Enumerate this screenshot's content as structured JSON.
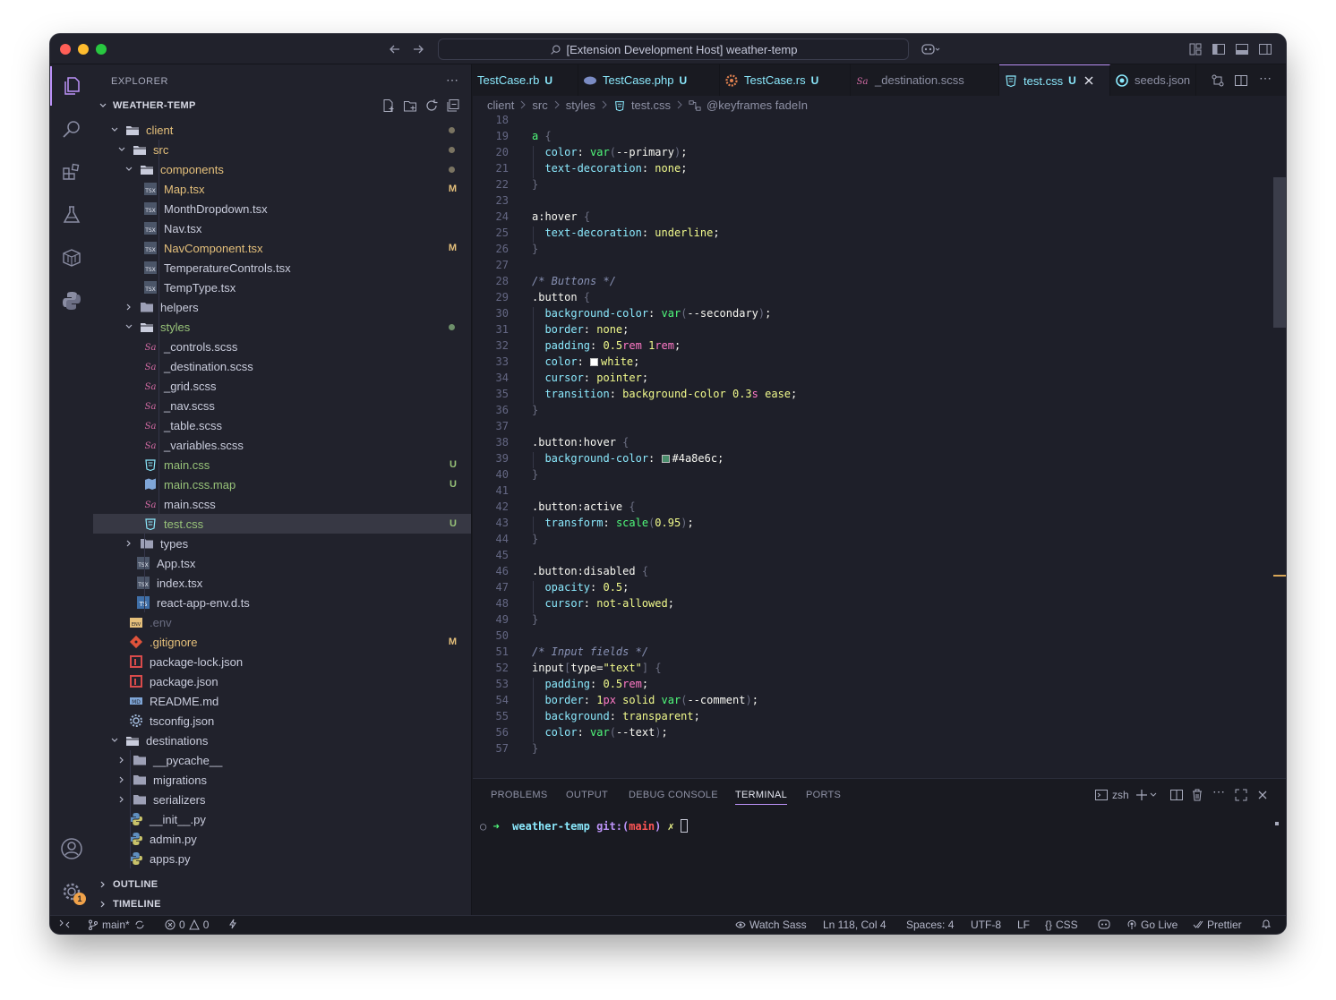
{
  "window": {
    "title": "[Extension Development Host] weather-temp"
  },
  "colors": {
    "accent": "#bd93f9",
    "modified": "#e5c07b",
    "untracked": "#98c379",
    "ignored": "#6b6e82"
  },
  "explorer": {
    "title": "EXPLORER",
    "root": "WEATHER-TEMP",
    "tree": [
      {
        "name": "client",
        "type": "folder",
        "depth": 0,
        "open": true,
        "dot": true,
        "color": "modified"
      },
      {
        "name": "src",
        "type": "folder",
        "depth": 1,
        "open": true,
        "dot": true,
        "color": "modified"
      },
      {
        "name": "components",
        "type": "folder",
        "depth": 2,
        "open": true,
        "dot": true,
        "color": "modified"
      },
      {
        "name": "Map.tsx",
        "type": "tsx",
        "depth": 3,
        "badge": "M",
        "color": "modified"
      },
      {
        "name": "MonthDropdown.tsx",
        "type": "tsx",
        "depth": 3
      },
      {
        "name": "Nav.tsx",
        "type": "tsx",
        "depth": 3
      },
      {
        "name": "NavComponent.tsx",
        "type": "tsx",
        "depth": 3,
        "badge": "M",
        "color": "modified"
      },
      {
        "name": "TemperatureControls.tsx",
        "type": "tsx",
        "depth": 3
      },
      {
        "name": "TempType.tsx",
        "type": "tsx",
        "depth": 3
      },
      {
        "name": "helpers",
        "type": "folder",
        "depth": 2,
        "open": false
      },
      {
        "name": "styles",
        "type": "folder",
        "depth": 2,
        "open": true,
        "dot": true,
        "color": "untracked"
      },
      {
        "name": "_controls.scss",
        "type": "scss",
        "depth": 3
      },
      {
        "name": "_destination.scss",
        "type": "scss",
        "depth": 3
      },
      {
        "name": "_grid.scss",
        "type": "scss",
        "depth": 3
      },
      {
        "name": "_nav.scss",
        "type": "scss",
        "depth": 3
      },
      {
        "name": "_table.scss",
        "type": "scss",
        "depth": 3
      },
      {
        "name": "_variables.scss",
        "type": "scss",
        "depth": 3
      },
      {
        "name": "main.css",
        "type": "css",
        "depth": 3,
        "badge": "U",
        "color": "untracked"
      },
      {
        "name": "main.css.map",
        "type": "map",
        "depth": 3,
        "badge": "U",
        "color": "untracked"
      },
      {
        "name": "main.scss",
        "type": "scss",
        "depth": 3
      },
      {
        "name": "test.css",
        "type": "css",
        "depth": 3,
        "badge": "U",
        "color": "untracked",
        "selected": true
      },
      {
        "name": "types",
        "type": "folder",
        "depth": 2,
        "open": false
      },
      {
        "name": "App.tsx",
        "type": "tsx",
        "depth": 2
      },
      {
        "name": "index.tsx",
        "type": "tsx",
        "depth": 2
      },
      {
        "name": "react-app-env.d.ts",
        "type": "ts",
        "depth": 2
      },
      {
        "name": ".env",
        "type": "env",
        "depth": 1,
        "color": "ignored"
      },
      {
        "name": ".gitignore",
        "type": "git",
        "depth": 1,
        "badge": "M",
        "color": "modified"
      },
      {
        "name": "package-lock.json",
        "type": "npm",
        "depth": 1
      },
      {
        "name": "package.json",
        "type": "npm",
        "depth": 1
      },
      {
        "name": "README.md",
        "type": "md",
        "depth": 1
      },
      {
        "name": "tsconfig.json",
        "type": "cfg",
        "depth": 1
      },
      {
        "name": "destinations",
        "type": "folder",
        "depth": 0,
        "open": true
      },
      {
        "name": "__pycache__",
        "type": "folder",
        "depth": 1,
        "open": false
      },
      {
        "name": "migrations",
        "type": "folder",
        "depth": 1,
        "open": false
      },
      {
        "name": "serializers",
        "type": "folder",
        "depth": 1,
        "open": false
      },
      {
        "name": "__init__.py",
        "type": "py",
        "depth": 1
      },
      {
        "name": "admin.py",
        "type": "py",
        "depth": 1
      },
      {
        "name": "apps.py",
        "type": "py",
        "depth": 1
      }
    ],
    "outline": "OUTLINE",
    "timeline": "TIMELINE"
  },
  "tabs": [
    {
      "label": "TestCase.rb",
      "status": "U",
      "icon": "ruby-icon",
      "color": "untracked"
    },
    {
      "label": "TestCase.php",
      "status": "U",
      "icon": "php-icon",
      "color": "untracked"
    },
    {
      "label": "TestCase.rs",
      "status": "U",
      "icon": "rust-icon",
      "color": "untracked"
    },
    {
      "label": "_destination.scss",
      "status": "",
      "icon": "sass-icon",
      "color": "plain"
    },
    {
      "label": "test.css",
      "status": "U",
      "icon": "css-icon",
      "color": "untracked",
      "active": true
    },
    {
      "label": "seeds.json",
      "status": "",
      "icon": "json-icon",
      "color": "plain"
    }
  ],
  "breadcrumb": [
    "client",
    "src",
    "styles",
    "test.css",
    "@keyframes fadeIn"
  ],
  "code": [
    {
      "n": "18",
      "t": []
    },
    {
      "n": "19",
      "t": [
        [
          "a ",
          "f"
        ],
        [
          "{",
          "g"
        ]
      ]
    },
    {
      "n": "20",
      "t": [
        [
          "  color",
          "k"
        ],
        [
          ": ",
          ""
        ],
        [
          "var",
          "f"
        ],
        [
          "(",
          "g"
        ],
        [
          "--primary",
          ""
        ],
        [
          ")",
          "g"
        ],
        [
          ";",
          ""
        ]
      ]
    },
    {
      "n": "21",
      "t": [
        [
          "  text-decoration",
          "k"
        ],
        [
          ": ",
          ""
        ],
        [
          "none",
          "v"
        ],
        [
          ";",
          ""
        ]
      ]
    },
    {
      "n": "22",
      "t": [
        [
          "}",
          "g"
        ]
      ]
    },
    {
      "n": "23",
      "t": []
    },
    {
      "n": "24",
      "t": [
        [
          "a",
          ""
        ],
        [
          ":hover ",
          ""
        ],
        [
          "{",
          "g"
        ]
      ]
    },
    {
      "n": "25",
      "t": [
        [
          "  text-decoration",
          "k"
        ],
        [
          ": ",
          ""
        ],
        [
          "underline",
          "v"
        ],
        [
          ";",
          ""
        ]
      ]
    },
    {
      "n": "26",
      "t": [
        [
          "}",
          "g"
        ]
      ]
    },
    {
      "n": "27",
      "t": []
    },
    {
      "n": "28",
      "t": [
        [
          "/* Buttons */",
          "cm"
        ]
      ]
    },
    {
      "n": "29",
      "t": [
        [
          ".button ",
          ""
        ],
        [
          "{",
          "g"
        ]
      ]
    },
    {
      "n": "30",
      "t": [
        [
          "  background-color",
          "k"
        ],
        [
          ": ",
          ""
        ],
        [
          "var",
          "f"
        ],
        [
          "(",
          "g"
        ],
        [
          "--secondary",
          ""
        ],
        [
          ")",
          "g"
        ],
        [
          ";",
          ""
        ]
      ]
    },
    {
      "n": "31",
      "t": [
        [
          "  border",
          "k"
        ],
        [
          ": ",
          ""
        ],
        [
          "none",
          "v"
        ],
        [
          ";",
          ""
        ]
      ]
    },
    {
      "n": "32",
      "t": [
        [
          "  padding",
          "k"
        ],
        [
          ": ",
          ""
        ],
        [
          "0.5",
          "v"
        ],
        [
          "rem ",
          "p"
        ],
        [
          "1",
          "v"
        ],
        [
          "rem",
          "p"
        ],
        [
          ";",
          ""
        ]
      ]
    },
    {
      "n": "33",
      "t": [
        [
          "  color",
          "k"
        ],
        [
          ": ",
          ""
        ],
        [
          "SW:#ffffff",
          ""
        ],
        [
          "white",
          "v"
        ],
        [
          ";",
          ""
        ]
      ]
    },
    {
      "n": "34",
      "t": [
        [
          "  cursor",
          "k"
        ],
        [
          ": ",
          ""
        ],
        [
          "pointer",
          "v"
        ],
        [
          ";",
          ""
        ]
      ]
    },
    {
      "n": "35",
      "t": [
        [
          "  transition",
          "k"
        ],
        [
          ": ",
          ""
        ],
        [
          "background-color ",
          "v"
        ],
        [
          "0.3",
          "v"
        ],
        [
          "s ",
          "p"
        ],
        [
          "ease",
          "v"
        ],
        [
          ";",
          ""
        ]
      ]
    },
    {
      "n": "36",
      "t": [
        [
          "}",
          "g"
        ]
      ]
    },
    {
      "n": "37",
      "t": []
    },
    {
      "n": "38",
      "t": [
        [
          ".button:hover ",
          ""
        ],
        [
          "{",
          "g"
        ]
      ]
    },
    {
      "n": "39",
      "t": [
        [
          "  background-color",
          "k"
        ],
        [
          ": ",
          ""
        ],
        [
          "SW:#4a8e6c",
          ""
        ],
        [
          "#4a8e6c",
          ""
        ],
        [
          ";",
          ""
        ]
      ]
    },
    {
      "n": "40",
      "t": [
        [
          "}",
          "g"
        ]
      ]
    },
    {
      "n": "41",
      "t": []
    },
    {
      "n": "42",
      "t": [
        [
          ".button:active ",
          ""
        ],
        [
          "{",
          "g"
        ]
      ]
    },
    {
      "n": "43",
      "t": [
        [
          "  transform",
          "k"
        ],
        [
          ": ",
          ""
        ],
        [
          "scale",
          "f"
        ],
        [
          "(",
          "g"
        ],
        [
          "0.95",
          "v"
        ],
        [
          ")",
          "g"
        ],
        [
          ";",
          ""
        ]
      ]
    },
    {
      "n": "44",
      "t": [
        [
          "}",
          "g"
        ]
      ]
    },
    {
      "n": "45",
      "t": []
    },
    {
      "n": "46",
      "t": [
        [
          ".button:disabled ",
          ""
        ],
        [
          "{",
          "g"
        ]
      ]
    },
    {
      "n": "47",
      "t": [
        [
          "  opacity",
          "k"
        ],
        [
          ": ",
          ""
        ],
        [
          "0.5",
          "v"
        ],
        [
          ";",
          ""
        ]
      ]
    },
    {
      "n": "48",
      "t": [
        [
          "  cursor",
          "k"
        ],
        [
          ": ",
          ""
        ],
        [
          "not-allowed",
          "v"
        ],
        [
          ";",
          ""
        ]
      ]
    },
    {
      "n": "49",
      "t": [
        [
          "}",
          "g"
        ]
      ]
    },
    {
      "n": "50",
      "t": []
    },
    {
      "n": "51",
      "t": [
        [
          "/* Input fields */",
          "cm"
        ]
      ]
    },
    {
      "n": "52",
      "t": [
        [
          "input",
          ""
        ],
        [
          "[",
          "g"
        ],
        [
          "type",
          ""
        ],
        [
          "=",
          ""
        ],
        [
          "\"text\"",
          "s"
        ],
        [
          "] ",
          "g"
        ],
        [
          "{",
          "g"
        ]
      ]
    },
    {
      "n": "53",
      "t": [
        [
          "  padding",
          "k"
        ],
        [
          ": ",
          ""
        ],
        [
          "0.5",
          "v"
        ],
        [
          "rem",
          "p"
        ],
        [
          ";",
          ""
        ]
      ]
    },
    {
      "n": "54",
      "t": [
        [
          "  border",
          "k"
        ],
        [
          ": ",
          ""
        ],
        [
          "1",
          "v"
        ],
        [
          "px ",
          "p"
        ],
        [
          "solid ",
          "v"
        ],
        [
          "var",
          "f"
        ],
        [
          "(",
          "g"
        ],
        [
          "--comment",
          ""
        ],
        [
          ")",
          "g"
        ],
        [
          ";",
          ""
        ]
      ]
    },
    {
      "n": "55",
      "t": [
        [
          "  background",
          "k"
        ],
        [
          ": ",
          ""
        ],
        [
          "transparent",
          "v"
        ],
        [
          ";",
          ""
        ]
      ]
    },
    {
      "n": "56",
      "t": [
        [
          "  color",
          "k"
        ],
        [
          ": ",
          ""
        ],
        [
          "var",
          "f"
        ],
        [
          "(",
          "g"
        ],
        [
          "--text",
          ""
        ],
        [
          ")",
          "g"
        ],
        [
          ";",
          ""
        ]
      ]
    },
    {
      "n": "57",
      "t": [
        [
          "}",
          "g"
        ]
      ]
    }
  ],
  "panel": {
    "tabs": [
      "PROBLEMS",
      "OUTPUT",
      "DEBUG CONSOLE",
      "TERMINAL",
      "PORTS"
    ],
    "active": "TERMINAL",
    "shell": "zsh",
    "prompt_dir": "weather-temp",
    "prompt_git": "git:(",
    "prompt_branch": "main",
    "prompt_close": ")",
    "prompt_mark": "✗"
  },
  "status": {
    "branch": "main*",
    "errors": "0",
    "warnings": "0",
    "watch_sass": "Watch Sass",
    "position": "Ln 118, Col 4",
    "spaces": "Spaces: 4",
    "encoding": "UTF-8",
    "eol": "LF",
    "language": "CSS",
    "golive": "Go Live",
    "prettier": "Prettier",
    "settings_badge": "1"
  }
}
